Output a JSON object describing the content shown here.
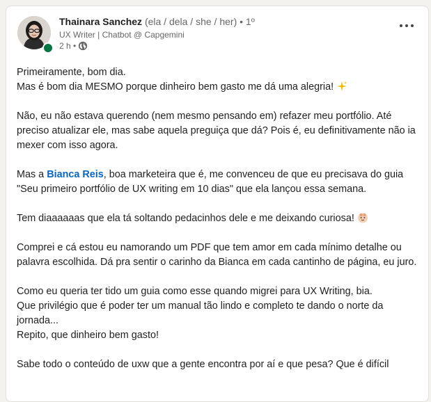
{
  "author": {
    "name": "Thainara Sanchez",
    "pronouns": "(ela / dela / she / her)",
    "degree": "• 1º",
    "headline": "UX Writer | Chatbot @ Capgemini",
    "time": "2 h •",
    "visibility_icon": "globe-icon",
    "status_color": "#057642"
  },
  "actions": {
    "more_icon": "more-horizontal-icon"
  },
  "post": {
    "p1_l1": "Primeiramente, bom dia.",
    "p1_l2": "Mas é bom dia MESMO porque dinheiro bem gasto me dá uma alegria! ",
    "p1_emoji": "sparkles-emoji",
    "p2": "Não, eu não estava querendo (nem mesmo pensando em) refazer meu portfólio. Até preciso atualizar ele, mas sabe aquela preguiça que dá? Pois é, eu definitivamente não ia mexer com isso agora.",
    "p3_pre": "Mas a ",
    "p3_mention": "Bianca Reis",
    "p3_post": ", boa marketeira que é, me convenceu de que eu precisava do guia \"Seu primeiro portfólio de UX writing em 10 dias\" que ela lançou essa semana.",
    "p4": "Tem diaaaaaas que ela tá soltando pedacinhos dele e me deixando curiosa! ",
    "p4_emoji": "smiling-face-emoji",
    "p5": "Comprei e cá estou eu namorando um PDF que tem amor em cada mínimo detalhe ou palavra escolhida. Dá pra sentir o carinho da Bianca em cada cantinho de página, eu juro.",
    "p6_l1": "Como eu queria ter tido um guia como esse quando migrei para UX Writing, bia.",
    "p6_l2": "Que privilégio que é poder ter um manual tão lindo e completo te dando o norte da jornada...",
    "p6_l3": "Repito, que dinheiro bem gasto!",
    "p7": "Sabe todo o conteúdo de uxw que a gente encontra por aí e que pesa? Que é difícil"
  },
  "colors": {
    "mention": "#0a66c2",
    "text": "#1f1f1f",
    "muted": "#666666"
  }
}
